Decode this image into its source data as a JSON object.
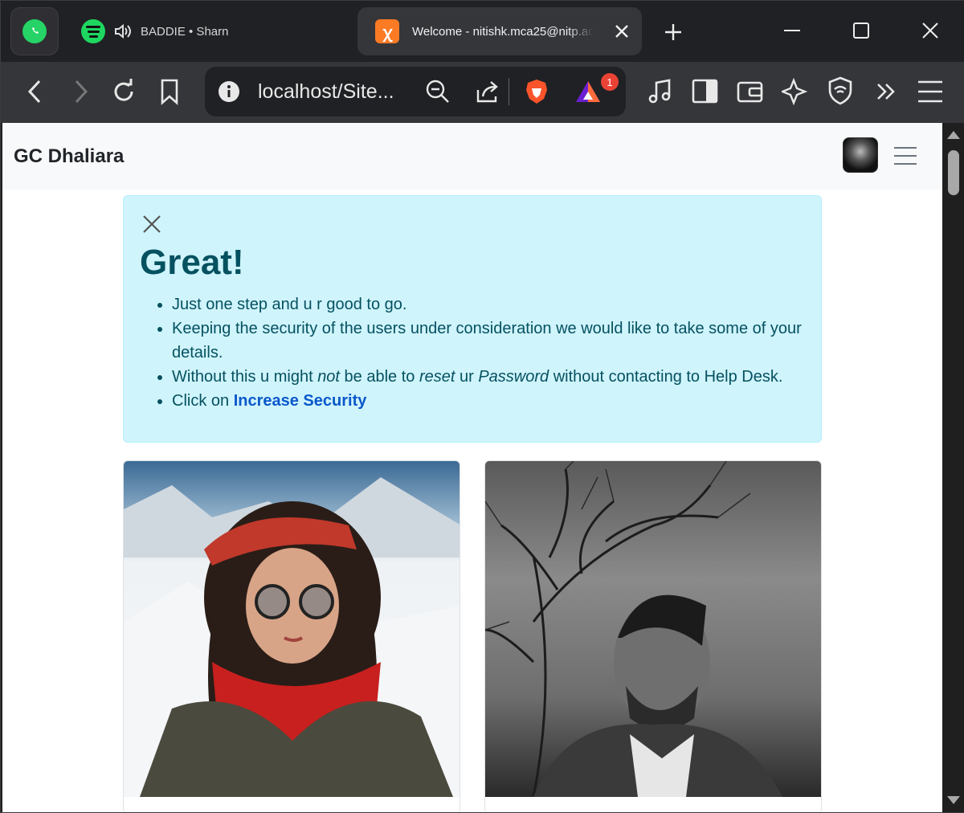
{
  "tabstrip": {
    "pinned_tab_icon": "whatsapp-icon",
    "media": {
      "icon": "spotify-icon",
      "sound_icon": "speaker-icon",
      "text": "BADDIE • Sharn"
    },
    "active_tab": {
      "favicon": "xampp-icon",
      "title": "Welcome - nitishk.mca25@nitp.ac"
    },
    "new_tab_icon": "plus-icon"
  },
  "toolbar": {
    "url": "localhost/Site...",
    "rewards_badge": "1"
  },
  "page": {
    "brand": "GC Dhaliara",
    "alert": {
      "title": "Great!",
      "items": [
        "Just one step and u r good to go.",
        "Keeping the security of the users under consideration we would like to take some of your details."
      ],
      "item3": {
        "p1": "Without this u might ",
        "em1": "not",
        "p2": " be able to ",
        "em2": "reset",
        "p3": " ur ",
        "em3": "Password",
        "p4": " without contacting to Help Desk."
      },
      "item4": {
        "prefix": "Click on ",
        "link": "Increase Security"
      }
    }
  },
  "colors": {
    "alert_bg": "#cff4fc",
    "alert_text": "#055160",
    "link": "#0a58ca",
    "navbar_bg": "#f8f9fa"
  }
}
